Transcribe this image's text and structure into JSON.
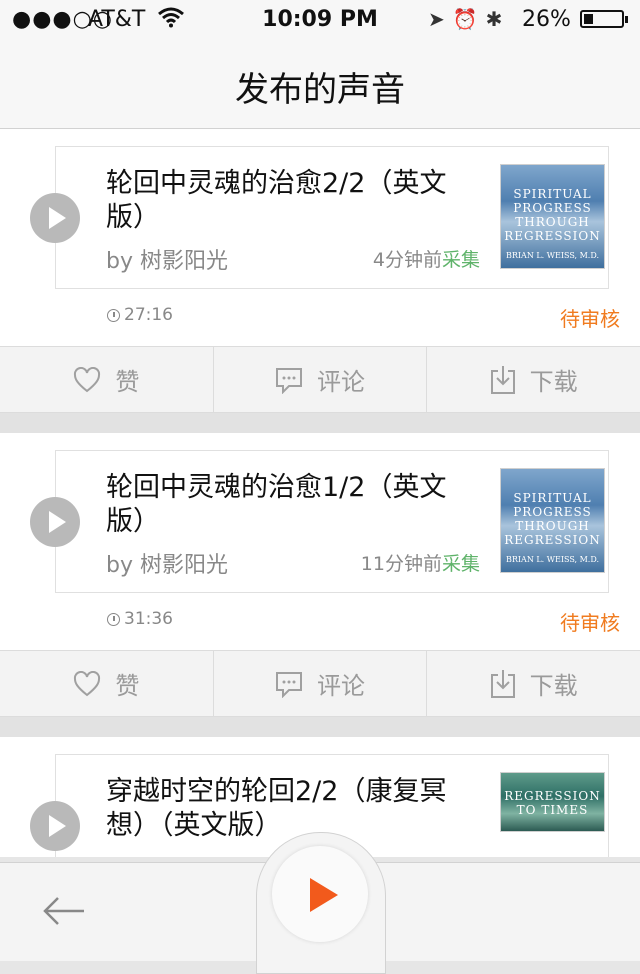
{
  "status": {
    "signal": "●●●○○",
    "carrier": "AT&T",
    "time": "10:09 PM",
    "battery_pct": "26%",
    "battery_level": 0.26
  },
  "nav": {
    "title": "发布的声音"
  },
  "posts": [
    {
      "title": "轮回中灵魂的治愈2/2（英文版）",
      "author": "by 树影阳光",
      "time_ago": "4分钟前",
      "collect": "采集",
      "duration": "27:16",
      "status": "待审核",
      "cover": {
        "title": "SPIRITUAL PROGRESS THROUGH REGRESSION",
        "author": "BRIAN L. WEISS, M.D."
      }
    },
    {
      "title": "轮回中灵魂的治愈1/2（英文版）",
      "author": "by 树影阳光",
      "time_ago": "11分钟前",
      "collect": "采集",
      "duration": "31:36",
      "status": "待审核",
      "cover": {
        "title": "SPIRITUAL PROGRESS THROUGH REGRESSION",
        "author": "BRIAN L. WEISS, M.D."
      }
    },
    {
      "title": "穿越时空的轮回2/2（康复冥想）（英文版）",
      "cover": {
        "title": "REGRESSION TO TIMES"
      }
    }
  ],
  "actions": {
    "like": "赞",
    "comment": "评论",
    "download": "下载"
  }
}
